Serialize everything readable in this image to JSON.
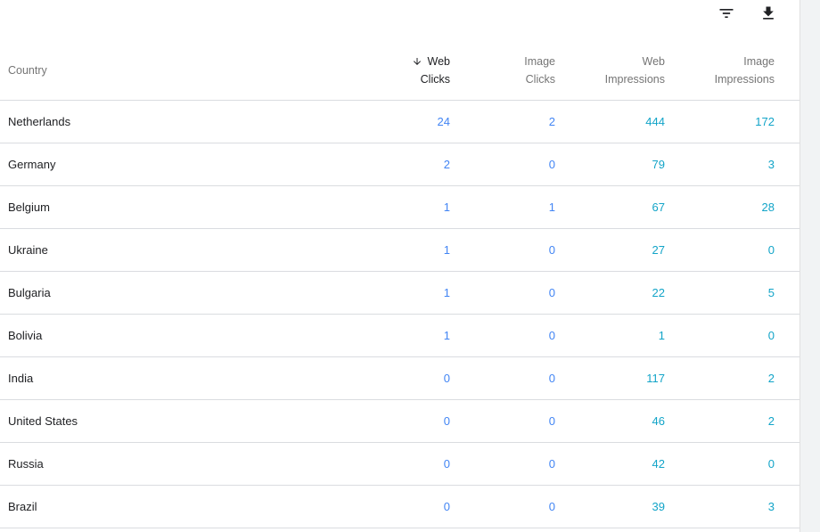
{
  "toolbar": {
    "filter_icon": "filter-list-icon",
    "download_icon": "download-icon"
  },
  "table": {
    "columns": {
      "country": "Country",
      "web_clicks": [
        "Web",
        "Clicks"
      ],
      "image_clicks": [
        "Image",
        "Clicks"
      ],
      "web_impressions": [
        "Web",
        "Impressions"
      ],
      "image_impressions": [
        "Image",
        "Impressions"
      ]
    },
    "sort": {
      "column": "web_clicks",
      "direction": "descending",
      "icon": "arrow-downward-icon"
    },
    "rows": [
      [
        "Netherlands",
        "24",
        "2",
        "444",
        "172"
      ],
      [
        "Germany",
        "2",
        "0",
        "79",
        "3"
      ],
      [
        "Belgium",
        "1",
        "1",
        "67",
        "28"
      ],
      [
        "Ukraine",
        "1",
        "0",
        "27",
        "0"
      ],
      [
        "Bulgaria",
        "1",
        "0",
        "22",
        "5"
      ],
      [
        "Bolivia",
        "1",
        "0",
        "1",
        "0"
      ],
      [
        "India",
        "0",
        "0",
        "117",
        "2"
      ],
      [
        "United States",
        "0",
        "0",
        "46",
        "2"
      ],
      [
        "Russia",
        "0",
        "0",
        "42",
        "0"
      ],
      [
        "Brazil",
        "0",
        "0",
        "39",
        "3"
      ]
    ]
  },
  "colors": {
    "clicks": "#4285f4",
    "impressions": "#12a4c8",
    "header_text": "#757575",
    "divider": "#dadce0"
  }
}
